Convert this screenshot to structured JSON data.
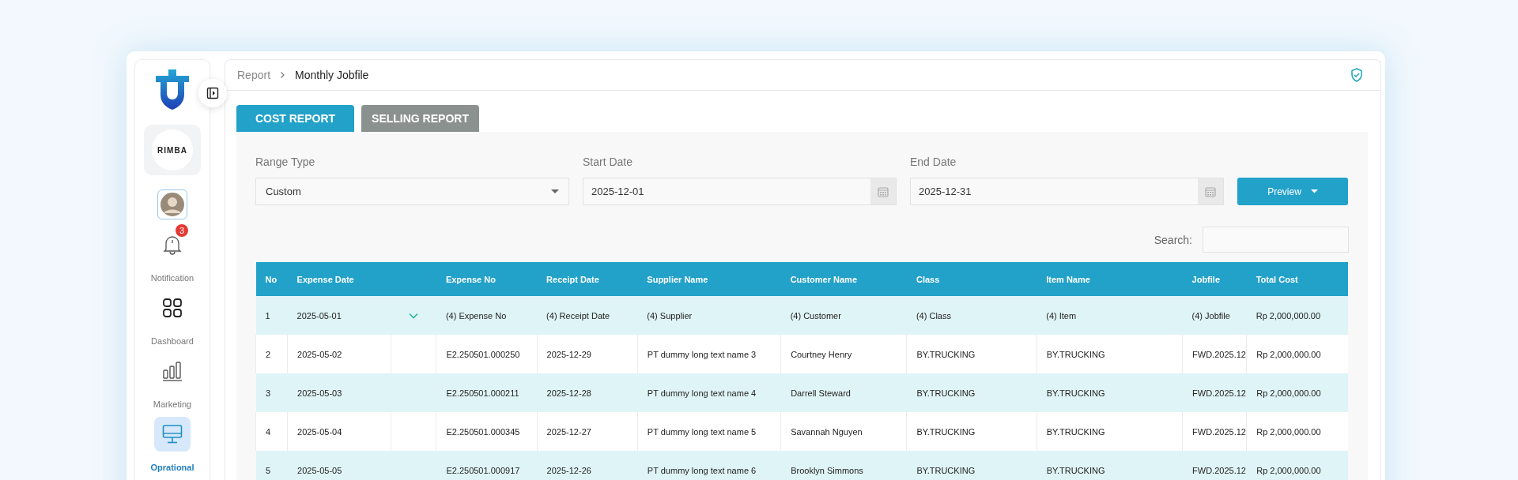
{
  "sidebar": {
    "company_logo": "RIMBA",
    "items": [
      {
        "label": "Notification",
        "badge": "3",
        "selected": false
      },
      {
        "label": "Dashboard",
        "selected": false
      },
      {
        "label": "Marketing",
        "selected": false
      },
      {
        "label": "Oprational",
        "selected": true
      }
    ]
  },
  "breadcrumb": [
    "Report",
    "Monthly Jobfile"
  ],
  "tabs": [
    {
      "label": "COST REPORT",
      "selected": true
    },
    {
      "label": "SELLING REPORT",
      "selected": false
    }
  ],
  "filters": {
    "range_type": {
      "label": "Range Type",
      "value": "Custom"
    },
    "start_date": {
      "label": "Start Date",
      "value": "2025-12-01"
    },
    "end_date": {
      "label": "End Date",
      "value": "2025-12-31"
    },
    "preview_button": "Preview",
    "search_label": "Search:"
  },
  "table": {
    "columns": [
      "No",
      "Expense Date",
      "Expense No",
      "Receipt Date",
      "Supplier Name",
      "Customer Name",
      "Class",
      "Item Name",
      "Jobfile",
      "Total Cost"
    ],
    "rows": [
      {
        "kind": "group",
        "expanded": true,
        "cells": [
          "1",
          "2025-05-01",
          "(4) Expense No",
          "(4) Receipt Date",
          "(4) Supplier",
          "(4) Customer",
          "(4) Class",
          "(4) Item",
          "(4) Jobfile",
          "Rp 2,000,000.00"
        ]
      },
      {
        "kind": "detail",
        "cells": [
          "2",
          "2025-05-02",
          "E2.250501.000250",
          "2025-12-29",
          "PT dummy long text name 3",
          "Courtney Henry",
          "BY.TRUCKING",
          "BY.TRUCKING",
          "FWD.2025.12",
          "Rp 2,000,000.00"
        ]
      },
      {
        "kind": "detail",
        "cells": [
          "3",
          "2025-05-03",
          "E2.250501.000211",
          "2025-12-28",
          "PT dummy long text name 4",
          "Darrell Steward",
          "BY.TRUCKING",
          "BY.TRUCKING",
          "FWD.2025.12",
          "Rp 2,000,000.00"
        ]
      },
      {
        "kind": "detail",
        "cells": [
          "4",
          "2025-05-04",
          "E2.250501.000345",
          "2025-12-27",
          "PT dummy long text name 5",
          "Savannah Nguyen",
          "BY.TRUCKING",
          "BY.TRUCKING",
          "FWD.2025.12",
          "Rp 2,000,000.00"
        ]
      },
      {
        "kind": "detail",
        "cells": [
          "5",
          "2025-05-05",
          "E2.250501.000917",
          "2025-12-26",
          "PT dummy long text name 6",
          "Brooklyn Simmons",
          "BY.TRUCKING",
          "BY.TRUCKING",
          "FWD.2025.12",
          "Rp 2,000,000.00"
        ]
      }
    ]
  }
}
